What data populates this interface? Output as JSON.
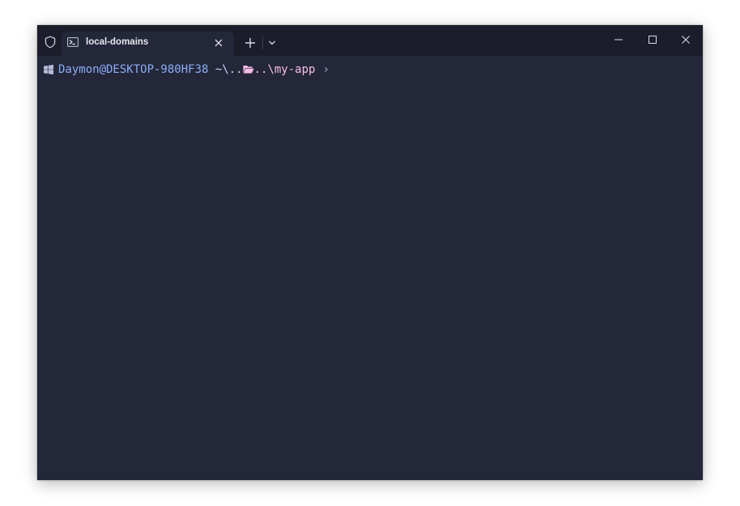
{
  "tab": {
    "title": "local-domains",
    "icon": "powershell-icon"
  },
  "titlebar": {
    "shield_icon": "shield-icon",
    "new_tab_icon": "plus-icon",
    "dropdown_icon": "chevron-down-icon",
    "window_controls": [
      "minimize-icon",
      "maximize-icon",
      "close-icon"
    ]
  },
  "prompt": {
    "os_icon": "windows-icon",
    "user_host": "Daymon@DESKTOP-980HF38",
    "path_prefix": "~\\..",
    "folder_icon": "folder-open-icon",
    "path_suffix": "..\\my-app",
    "symbol": "›"
  },
  "colors": {
    "terminal_background": "#24273a",
    "titlebar_background": "#1b1d2b",
    "user_host": "#8aadf4",
    "path_prefix": "#cad3f5",
    "path_suffix": "#f5bde6",
    "prompt_symbol": "#a5adcb"
  }
}
